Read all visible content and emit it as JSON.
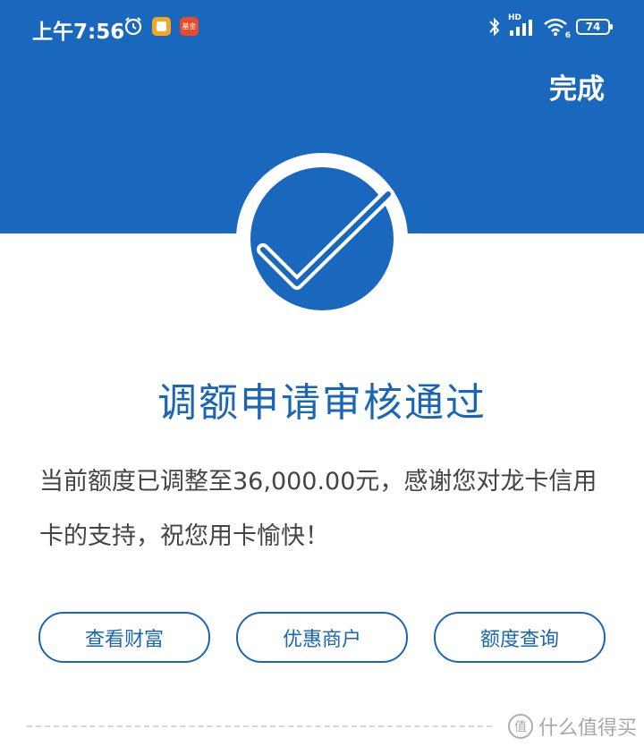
{
  "status_bar": {
    "time": "上午7:56",
    "battery": "74",
    "network": "HD",
    "wifi_label": "6",
    "icons": [
      "alarm-icon",
      "notes-app-icon",
      "red-app-icon",
      "bluetooth-icon",
      "signal-icon",
      "wifi-icon",
      "battery-icon"
    ],
    "red_app_label": "基金"
  },
  "header": {
    "done_label": "完成",
    "color": "#1968be"
  },
  "result": {
    "title": "调额申请审核通过",
    "message": "当前额度已调整至36,000.00元，感谢您对龙卡信用卡的支持，祝您用卡愉快！"
  },
  "actions": {
    "view_wealth": "查看财富",
    "merchant_offers": "优惠商户",
    "limit_query": "额度查询"
  },
  "watermark": {
    "text": "什么值得买",
    "logo": "值"
  },
  "colors": {
    "primary": "#1b66b4",
    "header_bg": "#1968be",
    "text": "#444444"
  }
}
